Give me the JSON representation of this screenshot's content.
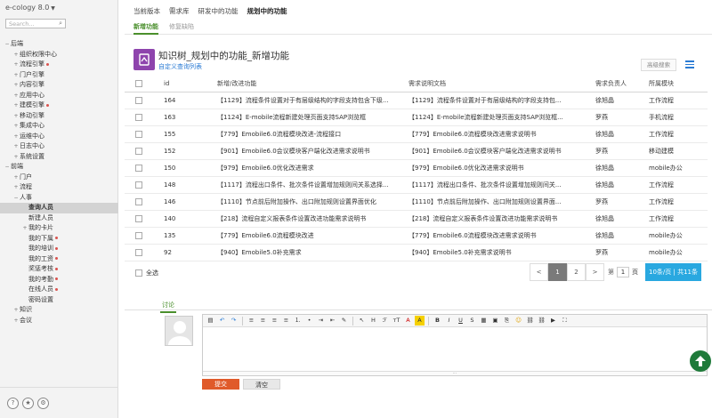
{
  "brand": {
    "name": "e-cology 8.0"
  },
  "sidebar": {
    "search_placeholder": "Search...",
    "tree": [
      {
        "label": "后端",
        "level": 0,
        "toggle": "−"
      },
      {
        "label": "组织权限中心",
        "level": 1,
        "toggle": "+"
      },
      {
        "label": "流程引擎",
        "level": 1,
        "toggle": "+",
        "dot": true
      },
      {
        "label": "门户引擎",
        "level": 1,
        "toggle": "+"
      },
      {
        "label": "内容引擎",
        "level": 1,
        "toggle": "+"
      },
      {
        "label": "应用中心",
        "level": 1,
        "toggle": "+"
      },
      {
        "label": "建模引擎",
        "level": 1,
        "toggle": "+",
        "dot": true
      },
      {
        "label": "移动引擎",
        "level": 1,
        "toggle": "+"
      },
      {
        "label": "集成中心",
        "level": 1,
        "toggle": "+"
      },
      {
        "label": "运维中心",
        "level": 1,
        "toggle": "+"
      },
      {
        "label": "日志中心",
        "level": 1,
        "toggle": "+"
      },
      {
        "label": "系统设置",
        "level": 1,
        "toggle": "+"
      },
      {
        "label": "前端",
        "level": 0,
        "toggle": "−"
      },
      {
        "label": "门户",
        "level": 1,
        "toggle": "+"
      },
      {
        "label": "流程",
        "level": 1,
        "toggle": "+"
      },
      {
        "label": "人事",
        "level": 1,
        "toggle": "−"
      },
      {
        "label": "查询人员",
        "level": 2,
        "selected": true
      },
      {
        "label": "新建人员",
        "level": 2
      },
      {
        "label": "我的卡片",
        "level": 2,
        "toggle": "+"
      },
      {
        "label": "我的下属",
        "level": 2,
        "dot": true
      },
      {
        "label": "我的培训",
        "level": 2,
        "dot": true
      },
      {
        "label": "我的工资",
        "level": 2,
        "dot": true
      },
      {
        "label": "奖惩考核",
        "level": 2,
        "dot": true
      },
      {
        "label": "我的考勤",
        "level": 2,
        "dot": true
      },
      {
        "label": "在线人员",
        "level": 2,
        "dot": true
      },
      {
        "label": "密码设置",
        "level": 2
      },
      {
        "label": "知识",
        "level": 1,
        "toggle": "+"
      },
      {
        "label": "会议",
        "level": 1,
        "toggle": "+"
      }
    ]
  },
  "tabs": [
    "当前版本",
    "需求库",
    "研发中的功能",
    "规划中的功能"
  ],
  "active_tab": 3,
  "subtabs": [
    "新增功能",
    "修复缺陷"
  ],
  "active_subtab": 0,
  "page": {
    "title": "知识树_规划中的功能_新增功能",
    "custom_link": "自定义查询列表",
    "adv_search": "高级搜索"
  },
  "table": {
    "headers": [
      "id",
      "新增/改进功能",
      "需求说明文档",
      "需求负责人",
      "所属模块"
    ],
    "rows": [
      [
        "164",
        "【1129】流程条件设置对于有层级结构的字段支持包含下级...",
        "【1129】流程条件设置对于有层级结构的字段支持包...",
        "徐旭晶",
        "工作流程"
      ],
      [
        "163",
        "【1124】E-mobile流程新建处理页面支持SAP浏览框",
        "【1124】E-mobile流程新建处理页面支持SAP浏览框...",
        "罗燕",
        "手机流程"
      ],
      [
        "155",
        "【779】Emobile6.0流程模块改进-流程接口",
        "【779】Emobile6.0流程模块改进需求说明书",
        "徐旭晶",
        "工作流程"
      ],
      [
        "152",
        "【901】Emobile6.0会议模块客户端化改进需求说明书",
        "【901】Emobile6.0会议模块客户端化改进需求说明书",
        "罗燕",
        "移动建模"
      ],
      [
        "150",
        "【979】Emobile6.0优化改进需求",
        "【979】Emobile6.0优化改进需求说明书",
        "徐旭晶",
        "mobile办公"
      ],
      [
        "148",
        "【1117】流程出口条件、批次条件设置增加规则间关系选择...",
        "【1117】流程出口条件、批次条件设置增加规则间关...",
        "徐旭晶",
        "工作流程"
      ],
      [
        "146",
        "【1110】节点前后附加操作、出口附加规则设置界面优化",
        "【1110】节点前后附加操作、出口附加规则设置界面...",
        "罗燕",
        "工作流程"
      ],
      [
        "140",
        "【218】流程自定义报表条件设置改进功能需求说明书",
        "【218】流程自定义报表条件设置改进功能需求说明书",
        "徐旭晶",
        "工作流程"
      ],
      [
        "135",
        "【779】Emobile6.0流程模块改进",
        "【779】Emobile6.0流程模块改进需求说明书",
        "徐旭晶",
        "mobile办公"
      ],
      [
        "92",
        "【940】Emobile5.0补充需求",
        "【940】Emobile5.0补充需求说明书",
        "罗燕",
        "mobile办公"
      ]
    ]
  },
  "footer": {
    "select_all": "全选",
    "prev": "<",
    "pages": [
      "1",
      "2"
    ],
    "current_page": "1",
    "next": ">",
    "goto_prefix": "第",
    "goto_value": "1",
    "goto_suffix": "页",
    "page_size": "10条/页 | 共11条"
  },
  "discussion": {
    "tab": "讨论",
    "submit": "提交",
    "clear": "清空"
  },
  "toolbar_icons": [
    "source-icon",
    "undo-icon",
    "redo-icon",
    "align-left-icon",
    "align-center-icon",
    "align-right-icon",
    "justify-icon",
    "ordered-list-icon",
    "unordered-list-icon",
    "indent-icon",
    "outdent-icon",
    "format-brush-icon",
    "cursor-icon",
    "heading-icon",
    "font-family-icon",
    "font-size-icon",
    "font-color-icon",
    "bg-color-icon",
    "bold-icon",
    "italic-icon",
    "underline-icon",
    "strikethrough-icon",
    "table-icon",
    "image-icon",
    "attachment-icon",
    "emoticon-icon",
    "link-icon",
    "unlink-icon",
    "video-icon",
    "fullscreen-icon"
  ],
  "colors": {
    "accent_green": "#4a8f2c",
    "link_blue": "#2a7bd4",
    "submit_orange": "#e05a2a",
    "page_size_blue": "#29a8e0",
    "title_icon_purple": "#8e44ad",
    "scroll_top_green": "#1f7a3a"
  }
}
